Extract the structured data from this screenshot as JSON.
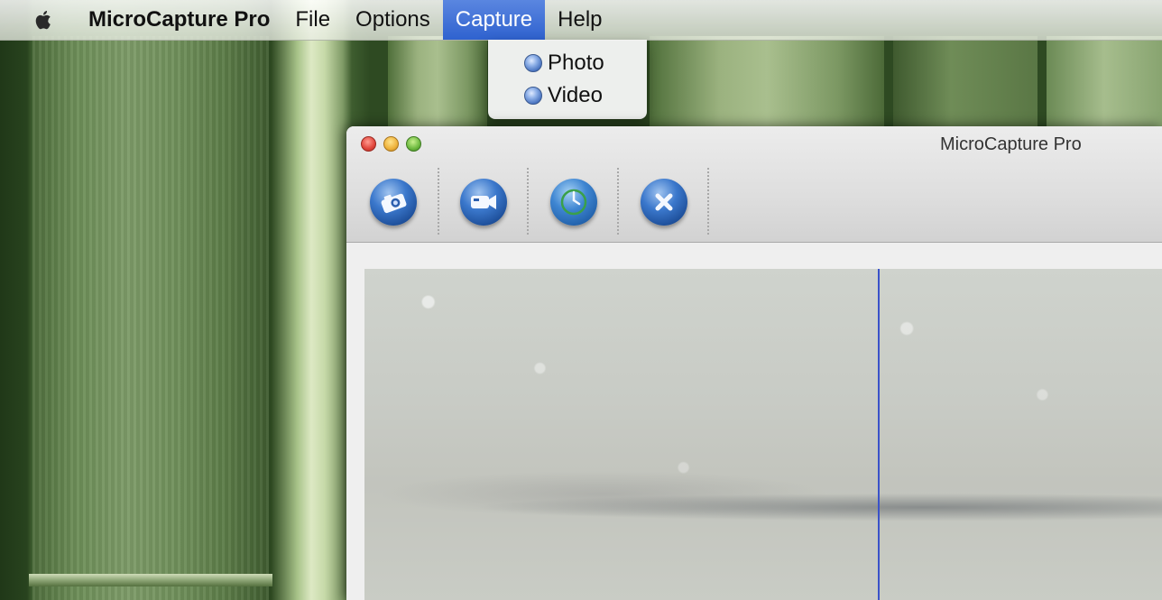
{
  "menubar": {
    "app_name": "MicroCapture Pro",
    "items": [
      {
        "label": "File"
      },
      {
        "label": "Options"
      },
      {
        "label": "Capture"
      },
      {
        "label": "Help"
      }
    ],
    "active_menu": "Capture"
  },
  "capture_menu": {
    "items": [
      {
        "label": "Photo",
        "icon": "photo-orb-icon"
      },
      {
        "label": "Video",
        "icon": "video-orb-icon"
      }
    ]
  },
  "window": {
    "title": "MicroCapture Pro",
    "toolbar": [
      {
        "name": "photo-capture-button",
        "icon": "camera-icon"
      },
      {
        "name": "video-capture-button",
        "icon": "video-camera-icon"
      },
      {
        "name": "refresh-button",
        "icon": "refresh-icon"
      },
      {
        "name": "close-button",
        "icon": "close-icon"
      }
    ]
  },
  "colors": {
    "menu_highlight": "#2f62cf",
    "crosshair": "#3a52c9",
    "toolbar_button": "#3b78cc"
  }
}
